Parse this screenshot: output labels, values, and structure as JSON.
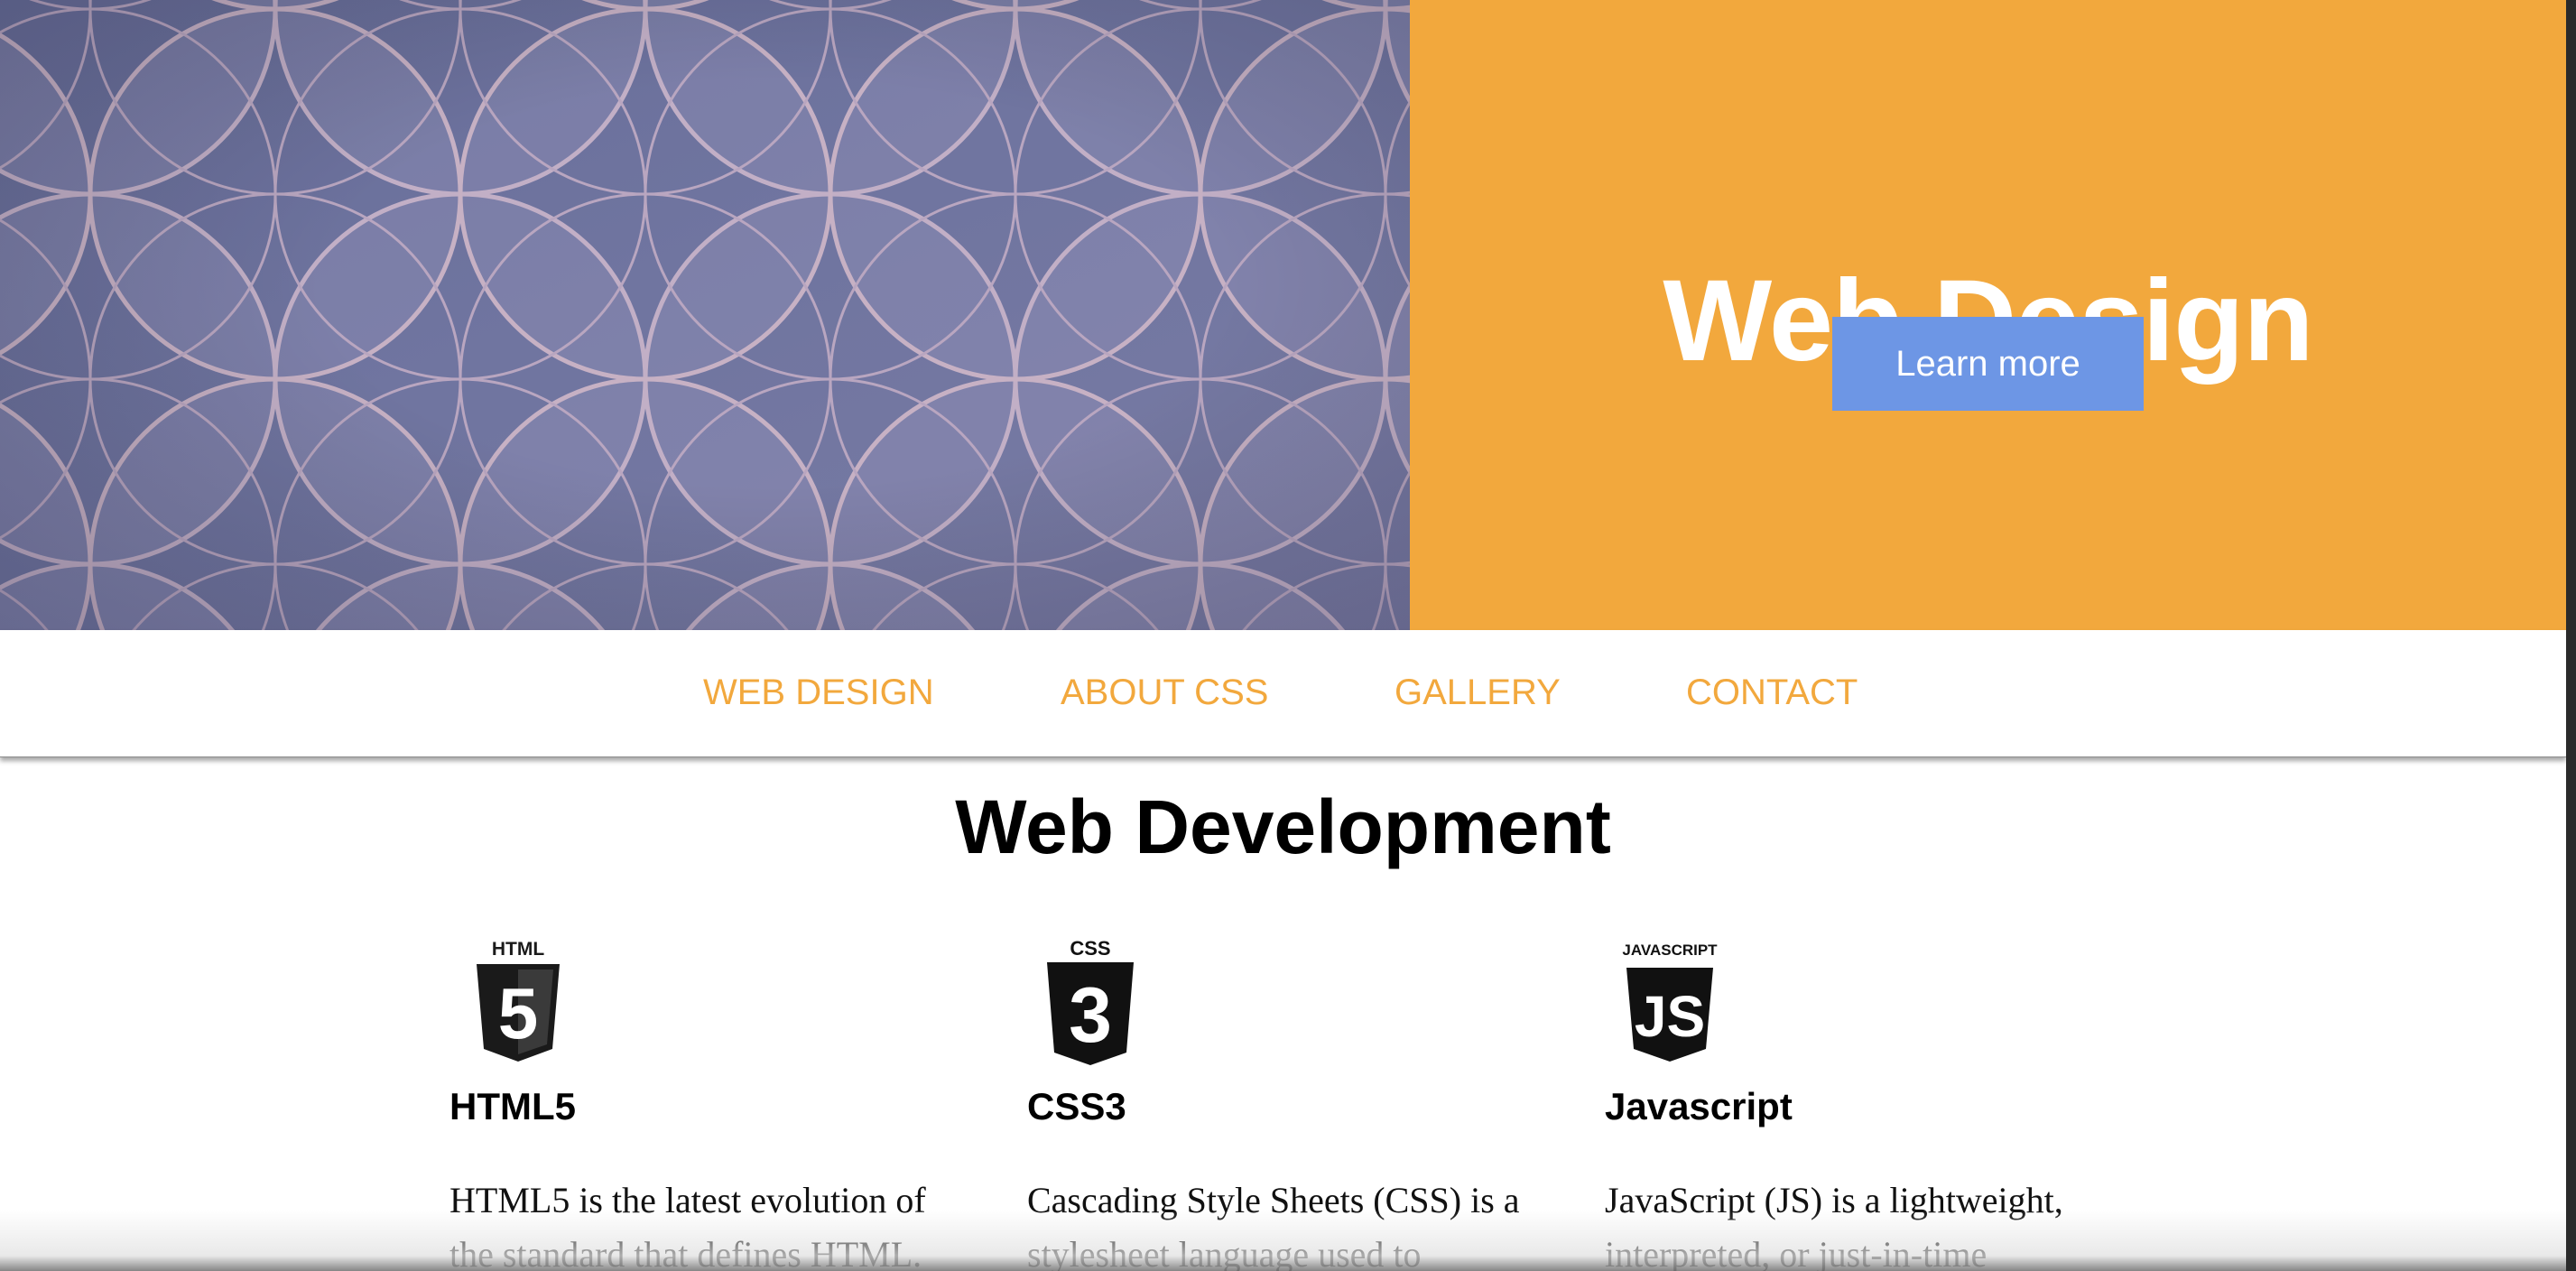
{
  "colors": {
    "accent": "#f2a83d",
    "button": "#6d96e5",
    "text": "#000000",
    "hero_image_base": "#59628c"
  },
  "hero": {
    "image_alt": "Blue and lilac interlocking circle pattern",
    "title": "Web Design",
    "button_label": "Learn more"
  },
  "nav": {
    "items": [
      {
        "label": "WEB DESIGN"
      },
      {
        "label": "ABOUT CSS"
      },
      {
        "label": "GALLERY"
      },
      {
        "label": "CONTACT"
      }
    ]
  },
  "main": {
    "title": "Web Development",
    "cards": [
      {
        "icon": "html5-shield-icon",
        "logo_caption": "HTML",
        "logo_number": "5",
        "heading": "HTML5",
        "text": "HTML5 is the latest evolution of the standard that defines HTML."
      },
      {
        "icon": "css3-shield-icon",
        "logo_caption": "CSS",
        "logo_number": "3",
        "heading": "CSS3",
        "text": "Cascading Style Sheets (CSS) is a stylesheet language used to"
      },
      {
        "icon": "javascript-shield-icon",
        "logo_caption": "JAVASCRIPT",
        "logo_number": "JS",
        "heading": "Javascript",
        "text": "JavaScript (JS) is a lightweight, interpreted, or just-in-time"
      }
    ]
  }
}
